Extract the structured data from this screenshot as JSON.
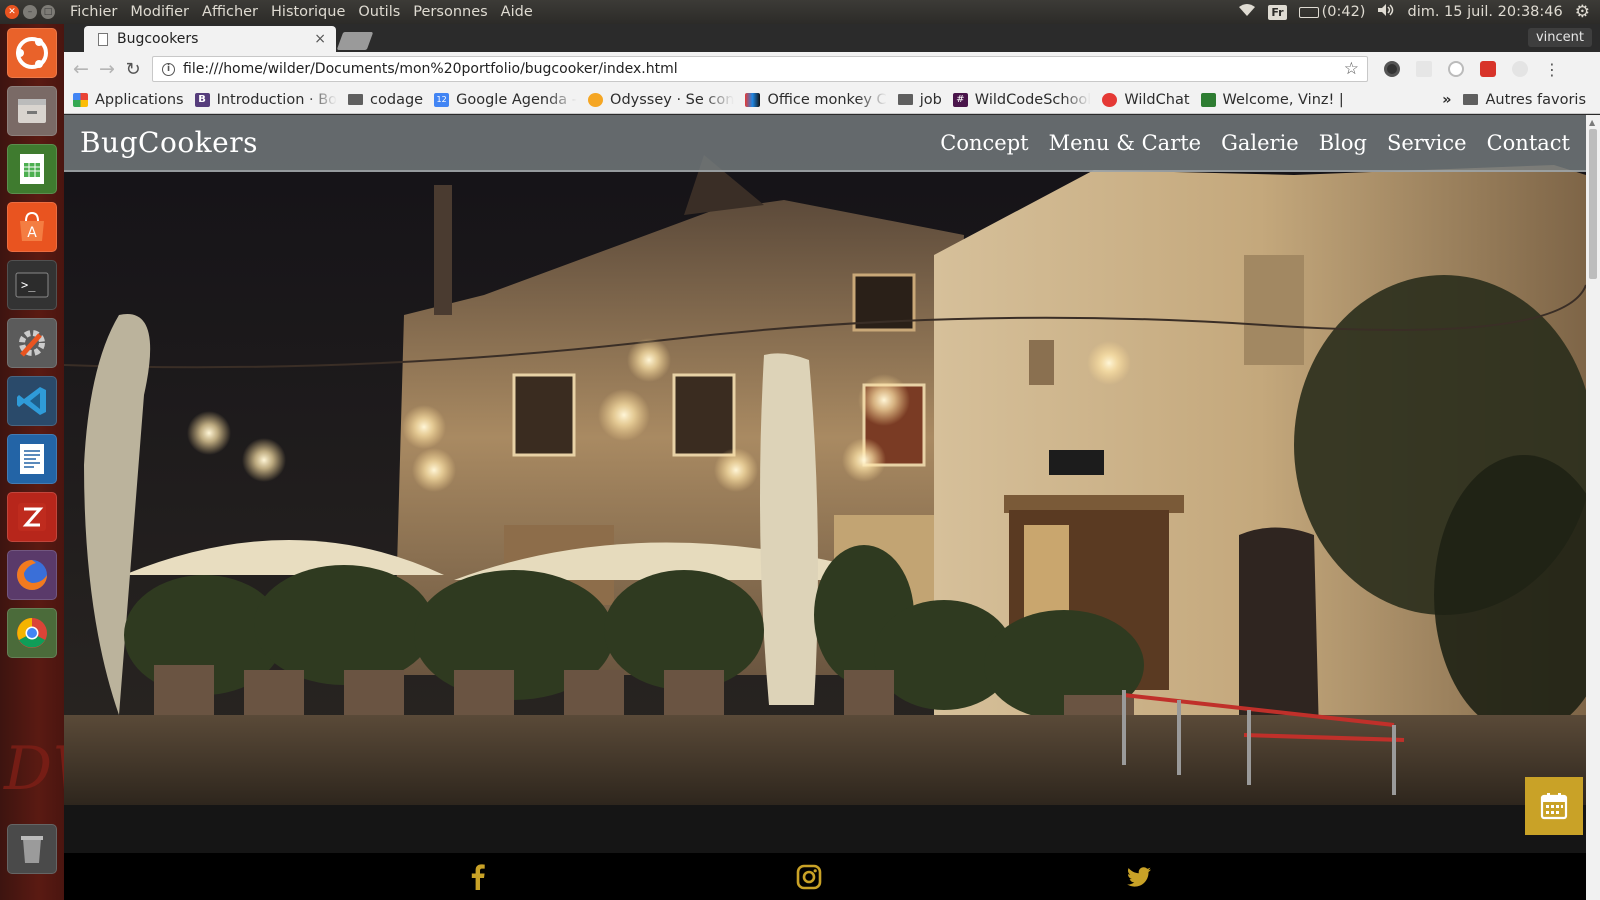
{
  "os": {
    "menu": [
      "Fichier",
      "Modifier",
      "Afficher",
      "Historique",
      "Outils",
      "Personnes",
      "Aide"
    ],
    "keyboard_layout": "Fr",
    "battery": "(0:42)",
    "datetime": "dim. 15 juil. 20:38:46"
  },
  "launcher": {
    "apps": [
      "ubuntu-dash",
      "files",
      "libreoffice-calc",
      "software-center",
      "terminal",
      "system-settings",
      "visual-studio-code",
      "libreoffice-writer",
      "filezilla",
      "firefox",
      "chrome",
      "trash"
    ]
  },
  "browser": {
    "tab_title": "Bugcookers",
    "tab_close": "×",
    "profile": "vincent",
    "url": "file:///home/wilder/Documents/mon%20portfolio/bugcooker/index.html",
    "bookmarks": [
      {
        "label": "Applications",
        "icon": "apps-grid-icon"
      },
      {
        "label": "Introduction · Bo",
        "icon": "bootstrap-icon"
      },
      {
        "label": "codage",
        "icon": "folder-icon"
      },
      {
        "label": "Google Agenda -",
        "icon": "calendar-icon"
      },
      {
        "label": "Odyssey · Se con",
        "icon": "odyssey-icon"
      },
      {
        "label": "Office monkey C",
        "icon": "office-monkey-icon"
      },
      {
        "label": "job",
        "icon": "folder-icon"
      },
      {
        "label": "WildCodeSchool",
        "icon": "slack-icon"
      },
      {
        "label": "WildChat",
        "icon": "wildchat-icon"
      },
      {
        "label": "Welcome, Vinz! |",
        "icon": "welcome-icon"
      }
    ],
    "more_bookmarks": "»",
    "other_bookmarks": "Autres favoris"
  },
  "site": {
    "brand": "BugCookers",
    "nav": [
      "Concept",
      "Menu & Carte",
      "Galerie",
      "Blog",
      "Service",
      "Contact"
    ],
    "hero_image": "restaurant courtyard at night",
    "social": [
      "facebook-icon",
      "instagram-icon",
      "twitter-icon"
    ],
    "floating_button": "calendar-icon",
    "accent": "#c9a227"
  }
}
